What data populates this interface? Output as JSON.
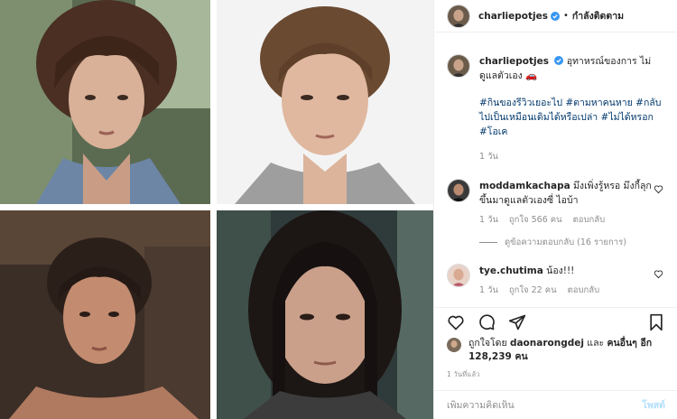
{
  "header": {
    "username": "charliepotjes",
    "separator": "•",
    "follow_status": "กำลังติดตาม"
  },
  "caption": {
    "username": "charliepotjes",
    "text": "อุทาหรณ์ของการ ไม่ดูแลตัวเอง 🚗",
    "hashtags": [
      "#กินของรีวิวเยอะไป",
      "#ตามหาคนหาย",
      "#กลับไปเป็นเหมือนเดิมได้หรือเปล่า",
      "#ไม่ได้หรอก",
      "#โอเค"
    ],
    "time": "1 วัน"
  },
  "comments": [
    {
      "username": "moddamkachapa",
      "text": "มึงเพิ่งรู้หรอ มึงกี้ลุกขึ้นมาดูแลตัวเองซี่ ไอบ้า",
      "time": "1 วัน",
      "likes": "ถูกใจ 566 คน",
      "reply": "ตอบกลับ"
    },
    {
      "username": "tye.chutima",
      "text": "น้อง!!!",
      "time": "1 วัน",
      "likes": "ถูกใจ 22 คน",
      "reply": "ตอบกลับ"
    }
  ],
  "view_replies": "ดูข้อความตอบกลับ (16 รายการ)",
  "liked_by": {
    "prefix": "ถูกใจโดย",
    "user": "daonarongdej",
    "and": "และ",
    "others": "คนอื่นๆ อีก 128,239 คน"
  },
  "post_date": "1 วันที่แล้ว",
  "add_comment": {
    "placeholder": "เพิ่มความคิดเห็น",
    "post_label": "โพสต์"
  },
  "icons": {
    "verified": "verified-badge-icon",
    "heart": "heart-icon",
    "comment": "comment-icon",
    "share": "share-icon",
    "bookmark": "bookmark-icon"
  },
  "colors": {
    "verified": "#3897f0",
    "link": "#00376b",
    "muted": "#8e8e8e",
    "post_disabled": "#b2dffc"
  }
}
